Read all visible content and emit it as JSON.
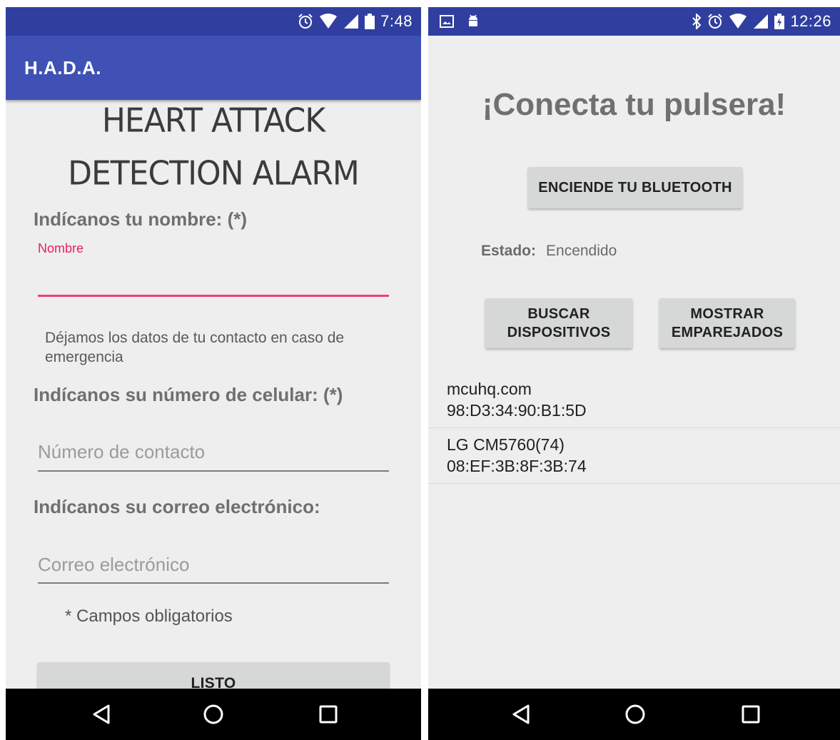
{
  "left": {
    "status_bar": {
      "time": "7:48",
      "icons": [
        "alarm-icon",
        "wifi-icon",
        "signal-icon",
        "battery-icon"
      ]
    },
    "app_bar": {
      "title": "H.A.D.A."
    },
    "hero": {
      "line1": "HEART ATTACK",
      "line2": "DETECTION ALARM"
    },
    "name_section": {
      "label": "Indícanos tu nombre: (*)",
      "float_label": "Nombre",
      "value": ""
    },
    "emergency_hint": {
      "line1": "Déjamos los datos de tu contacto en caso de",
      "line2": "emergencia"
    },
    "phone_section": {
      "label": "Indícanos su número de celular: (*)",
      "placeholder": "Número de contacto"
    },
    "email_section": {
      "label": "Indícanos su correo electrónico:",
      "placeholder": "Correo electrónico"
    },
    "required_note": "* Campos obligatorios",
    "submit_button": "LISTO",
    "nav_icons": [
      "back-icon",
      "home-icon",
      "recents-icon"
    ]
  },
  "right": {
    "status_bar": {
      "time": "12:26",
      "icons": [
        "gallery-icon",
        "android-icon",
        "bluetooth-icon",
        "alarm-icon",
        "wifi-icon",
        "signal-icon",
        "battery-charging-icon"
      ]
    },
    "title": "¡Conecta tu pulsera!",
    "bluetooth_button": "ENCIENDE TU BLUETOOTH",
    "state": {
      "key": "Estado:",
      "value": "Encendido"
    },
    "search_button": {
      "line1": "BUSCAR",
      "line2": "DISPOSITIVOS"
    },
    "paired_button": {
      "line1": "MOSTRAR",
      "line2": "EMPAREJADOS"
    },
    "devices": [
      {
        "name": "mcuhq.com",
        "address": "98:D3:34:90:B1:5D"
      },
      {
        "name": "LG CM5760(74)",
        "address": "08:EF:3B:8F:3B:74"
      }
    ],
    "nav_icons": [
      "back-icon",
      "home-icon",
      "recents-icon"
    ]
  },
  "colors": {
    "primary": "#3f51b5",
    "primary_dark": "#303f9f",
    "accent": "#ec407a",
    "background": "#eeeeee"
  }
}
